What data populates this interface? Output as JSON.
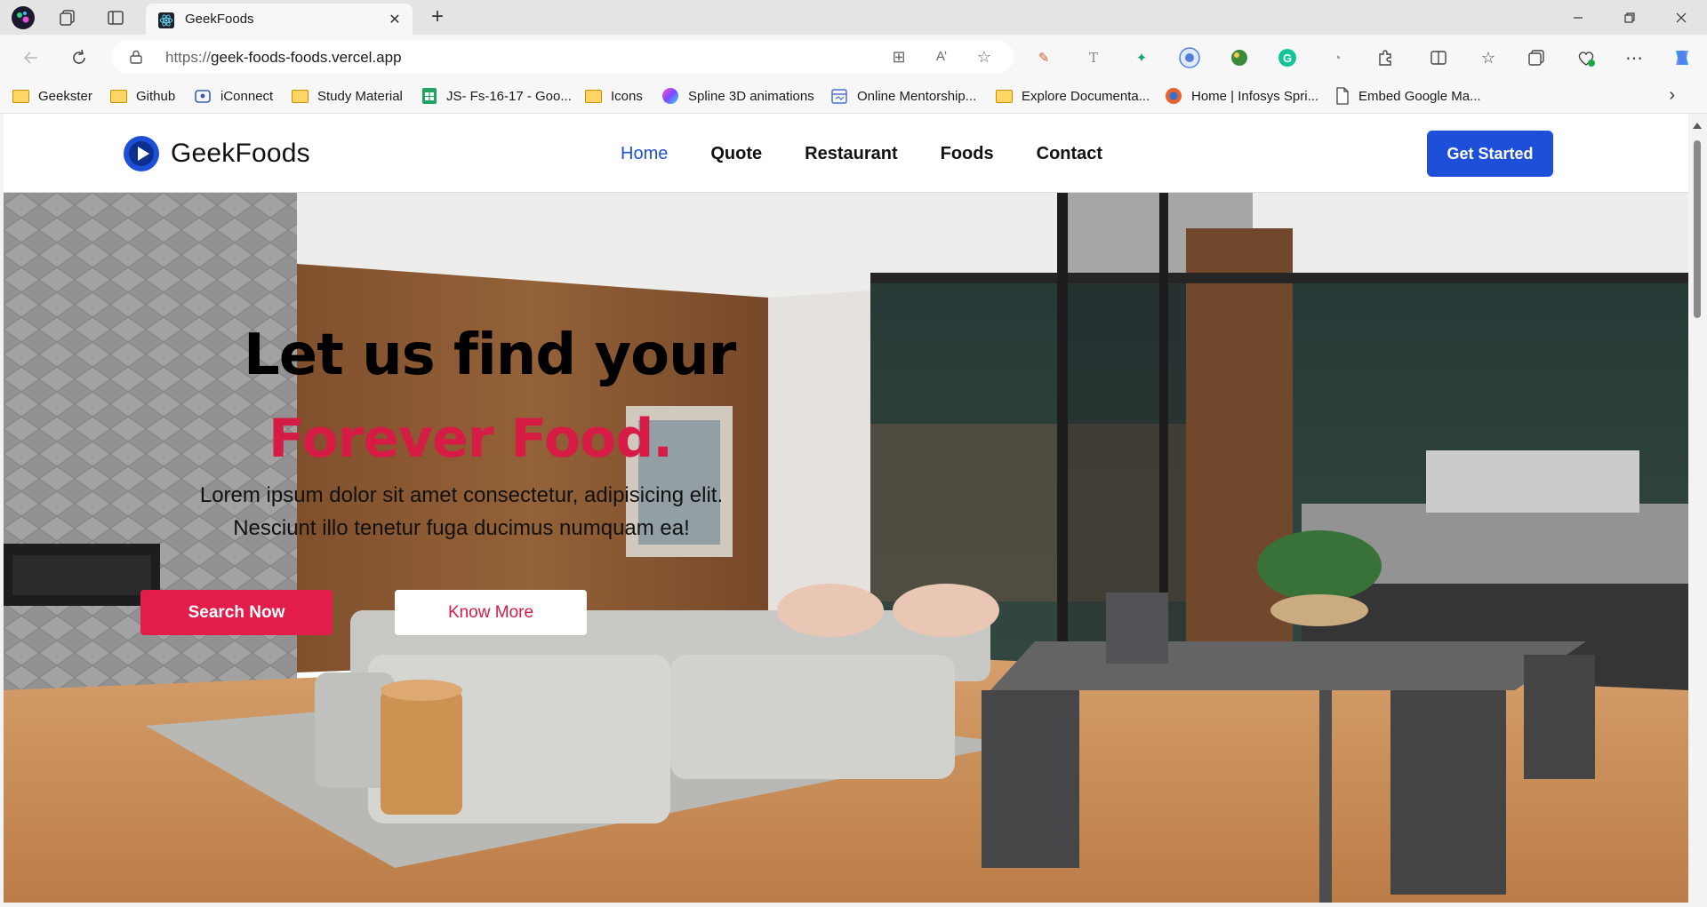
{
  "browser": {
    "tab": {
      "title": "GeekFoods"
    },
    "url": {
      "scheme": "https://",
      "host": "geek-foods-foods.vercel.app"
    },
    "bookmarks": [
      {
        "label": "Geekster",
        "icon": "folder-icon"
      },
      {
        "label": "Github",
        "icon": "folder-icon"
      },
      {
        "label": "iConnect",
        "icon": "iconnect-icon"
      },
      {
        "label": "Study Material",
        "icon": "folder-icon"
      },
      {
        "label": "JS- Fs-16-17 - Goo...",
        "icon": "sheets-icon"
      },
      {
        "label": "Icons",
        "icon": "folder-icon"
      },
      {
        "label": "Spline 3D animations",
        "icon": "spline-icon"
      },
      {
        "label": "Online Mentorship...",
        "icon": "calendar-icon"
      },
      {
        "label": "Explore Documenta...",
        "icon": "folder-icon"
      },
      {
        "label": "Home | Infosys Spri...",
        "icon": "infosys-icon"
      },
      {
        "label": "Embed Google Ma...",
        "icon": "page-icon"
      }
    ]
  },
  "site": {
    "brand": "GeekFoods",
    "nav": [
      {
        "label": "Home",
        "active": true
      },
      {
        "label": "Quote",
        "active": false
      },
      {
        "label": "Restaurant",
        "active": false
      },
      {
        "label": "Foods",
        "active": false
      },
      {
        "label": "Contact",
        "active": false
      }
    ],
    "cta_label": "Get Started",
    "hero": {
      "headline_line1": "Let us find your",
      "headline_line2": "Forever Food.",
      "lead_line1": "Lorem ipsum dolor sit amet consectetur, adipisicing elit.",
      "lead_line2": "Nesciunt illo tenetur fuga ducimus numquam ea!",
      "primary_button": "Search Now",
      "secondary_button": "Know More"
    },
    "colors": {
      "accent": "#1e4fd8",
      "brand_red": "#e21d49"
    }
  }
}
